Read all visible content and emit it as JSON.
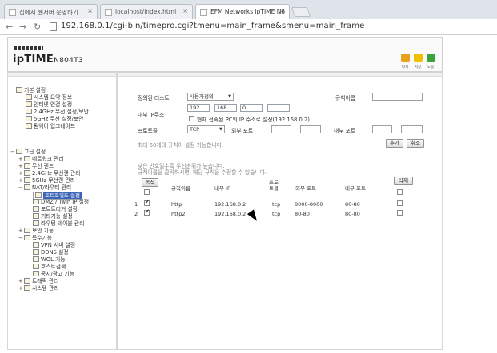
{
  "browser": {
    "tabs": [
      {
        "label": "집에서 웹서버 운영하기"
      },
      {
        "label": "localhost/index.html"
      },
      {
        "label": "EFM Networks ipTIME N8"
      }
    ],
    "url": "192.168.0.1/cgi-bin/timepro.cgi?tmenu=main_frame&smenu=main_frame"
  },
  "header": {
    "brand": "ipTIME",
    "model": "N804T3",
    "icons": [
      {
        "name": "reload-icon",
        "label": "다시",
        "color": "#e8a21a"
      },
      {
        "name": "save-icon",
        "label": "저장",
        "color": "#f0c000"
      },
      {
        "name": "help-icon",
        "label": "도움",
        "color": "#3aa43a"
      }
    ]
  },
  "sidebar": {
    "items": [
      {
        "label": "기본 설정",
        "plus": ""
      },
      {
        "label": "시스템 요약 정보",
        "plus": ""
      },
      {
        "label": "인터넷 연결 설정",
        "plus": ""
      },
      {
        "label": "2.4GHz 무선 설정/보안",
        "plus": ""
      },
      {
        "label": "5GHz 무선 설정/보안",
        "plus": ""
      },
      {
        "label": "펌웨어 업그레이드",
        "plus": ""
      },
      {
        "label": "고급 설정",
        "plus": "−"
      },
      {
        "label": "네트워크 관리",
        "plus": "+"
      },
      {
        "label": "무선 랜드",
        "plus": "+"
      },
      {
        "label": "2.4GHz 무선랜 관리",
        "plus": "+"
      },
      {
        "label": "5GHz 무선랜 관리",
        "plus": "+"
      },
      {
        "label": "NAT/라우터 관리",
        "plus": "−"
      },
      {
        "label": "포트포워드 설정",
        "plus": ""
      },
      {
        "label": "DMZ / Twin IP 설정",
        "plus": ""
      },
      {
        "label": "포트트리거 설정",
        "plus": ""
      },
      {
        "label": "기타기능 설정",
        "plus": ""
      },
      {
        "label": "라우팅 테이블 관리",
        "plus": ""
      },
      {
        "label": "보안 기능",
        "plus": "+"
      },
      {
        "label": "특수기능",
        "plus": "−"
      },
      {
        "label": "VPN 서버 설정",
        "plus": ""
      },
      {
        "label": "DDNS 설정",
        "plus": ""
      },
      {
        "label": "WOL 기능",
        "plus": ""
      },
      {
        "label": "호스트검색",
        "plus": ""
      },
      {
        "label": "공지/광고 기능",
        "plus": ""
      },
      {
        "label": "트래픽 관리",
        "plus": "+"
      },
      {
        "label": "시스템 관리",
        "plus": "+"
      }
    ]
  },
  "form": {
    "rule_list_label": "정의된 리스트",
    "rule_list_value": "사용자정의",
    "rule_name_label": "규칙이름",
    "rule_name_value": "",
    "internal_ip_label": "내부 IP주소",
    "ip1": "192",
    "ip2": "168",
    "ip3": "0",
    "ip4": "",
    "current_ip_text": "현재 접속된 PC의 IP 주소로 설정(192.168.0.2)",
    "protocol_label": "프로토콜",
    "protocol_value": "TCP",
    "ext_port_label": "외부 포트",
    "int_port_label": "내부 포트",
    "tilde": "~",
    "limit_note": "최대 60개의 규칙이 설정 가능합니다.",
    "add_button": "추가",
    "cancel_button": "취소"
  },
  "notes": {
    "line1": "낮은 번호일수록 우선순위가 높습니다.",
    "line2": "규칙이름을 클릭하시면, 해당 규칙을 수정할 수 있습니다."
  },
  "table": {
    "headers": {
      "enable": "동작",
      "name": "규칙이름",
      "ip": "내부 IP",
      "protocol": "프로토콜",
      "ext_port": "외부 포트",
      "int_port": "내부 포트",
      "delete": "삭제"
    },
    "rows": [
      {
        "no": "1",
        "enabled": true,
        "name": "http",
        "ip": "192.168.0.2",
        "protocol": "tcp",
        "ext_port": "8000-8000",
        "int_port": "80-80"
      },
      {
        "no": "2",
        "enabled": true,
        "name": "http2",
        "ip": "192.168.0.2",
        "protocol": "tcp",
        "ext_port": "80-80",
        "int_port": "80-80"
      }
    ]
  }
}
